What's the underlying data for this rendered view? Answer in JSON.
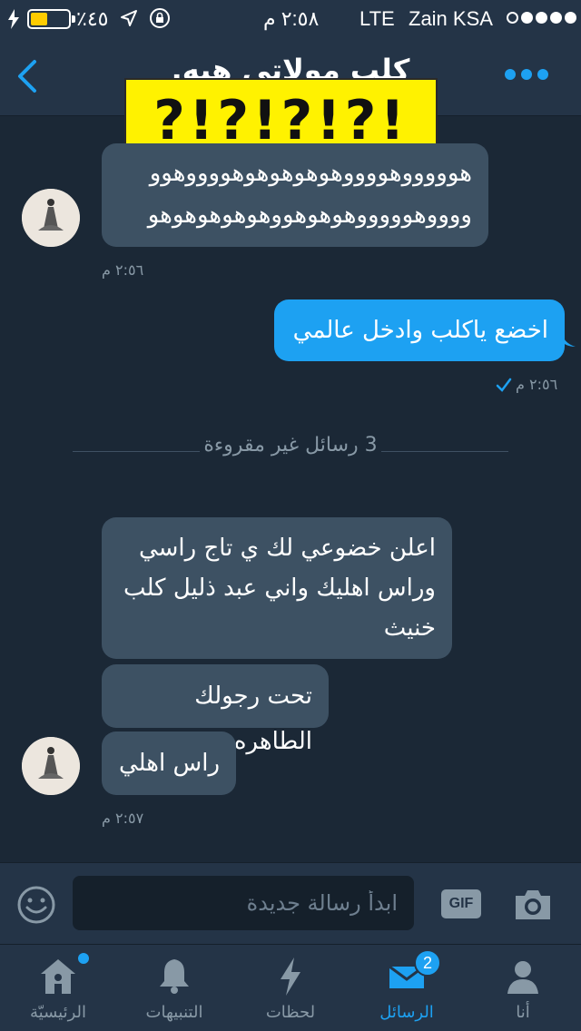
{
  "status_bar": {
    "carrier": "Zain KSA",
    "network": "LTE",
    "time": "٢:٥٨ م",
    "battery_percent": "٪٤٥",
    "battery_level": 0.45
  },
  "header": {
    "title": "كلب مولاتي هبه."
  },
  "overlay": {
    "text": "?!?!?!?!"
  },
  "messages": [
    {
      "direction": "incoming",
      "lines": [
        "هوووووهووووهوهوهوهوهووووهوو",
        "ووووهوووووهوهوهووهوهوهوهوهو"
      ]
    },
    {
      "timestamp": "٢:٥٦ م"
    },
    {
      "direction": "outgoing",
      "text": "اخضع ياكلب وادخل عالمي",
      "timestamp": "٢:٥٦ م"
    },
    {
      "unread_divider": "3 رسائل غير مقروءة"
    },
    {
      "direction": "incoming",
      "lines": [
        "اعلن خضوعي لك ي تاج راسي",
        "وراس اهليك واني عبد ذليل كلب",
        "خنيث"
      ]
    },
    {
      "direction": "incoming",
      "text": "تحت رجولك الطاهره"
    },
    {
      "direction": "incoming",
      "text": "راس اهلي",
      "timestamp": "٢:٥٧ م"
    }
  ],
  "composer": {
    "placeholder": "ابدأ رسالة جديدة",
    "gif_label": "GIF"
  },
  "tabs": [
    {
      "label": "أنا",
      "icon": "profile-icon"
    },
    {
      "label": "الرسائل",
      "icon": "envelope-icon",
      "active": true,
      "badge": "2"
    },
    {
      "label": "لحظات",
      "icon": "lightning-icon"
    },
    {
      "label": "التنبيهات",
      "icon": "bell-icon"
    },
    {
      "label": "الرئيسيّة",
      "icon": "home-icon",
      "has_dot": true
    }
  ],
  "colors": {
    "accent": "#1da1f2",
    "background": "#1b2836",
    "bar": "#243447",
    "incoming_bubble": "#3d5163",
    "sticker": "#fff200"
  }
}
